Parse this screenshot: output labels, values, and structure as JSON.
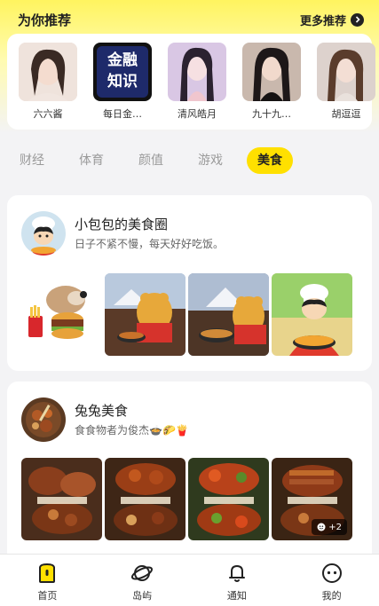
{
  "recommend": {
    "title": "为你推荐",
    "more_label": "更多推荐",
    "items": [
      {
        "name": "六六酱"
      },
      {
        "name": "每日金…",
        "avatar_text_1": "金融",
        "avatar_text_2": "知识"
      },
      {
        "name": "清风皓月"
      },
      {
        "name": "九十九…"
      },
      {
        "name": "胡逗逗"
      }
    ]
  },
  "tabs": [
    "财经",
    "体育",
    "颜值",
    "游戏",
    "美食"
  ],
  "active_tab": "美食",
  "posts": [
    {
      "title": "小包包的美食圈",
      "desc": "日子不紧不慢，每天好好吃饭。"
    },
    {
      "title": "兔兔美食",
      "desc": "食食物者为俊杰🍲🌮🍟",
      "more_count": "+2"
    }
  ],
  "nav": [
    {
      "label": "首页",
      "icon": "home-icon"
    },
    {
      "label": "岛屿",
      "icon": "planet-icon"
    },
    {
      "label": "通知",
      "icon": "bell-icon"
    },
    {
      "label": "我的",
      "icon": "profile-icon"
    }
  ],
  "colors": {
    "accent": "#ffe000",
    "top_gradient": "#fff45f"
  }
}
